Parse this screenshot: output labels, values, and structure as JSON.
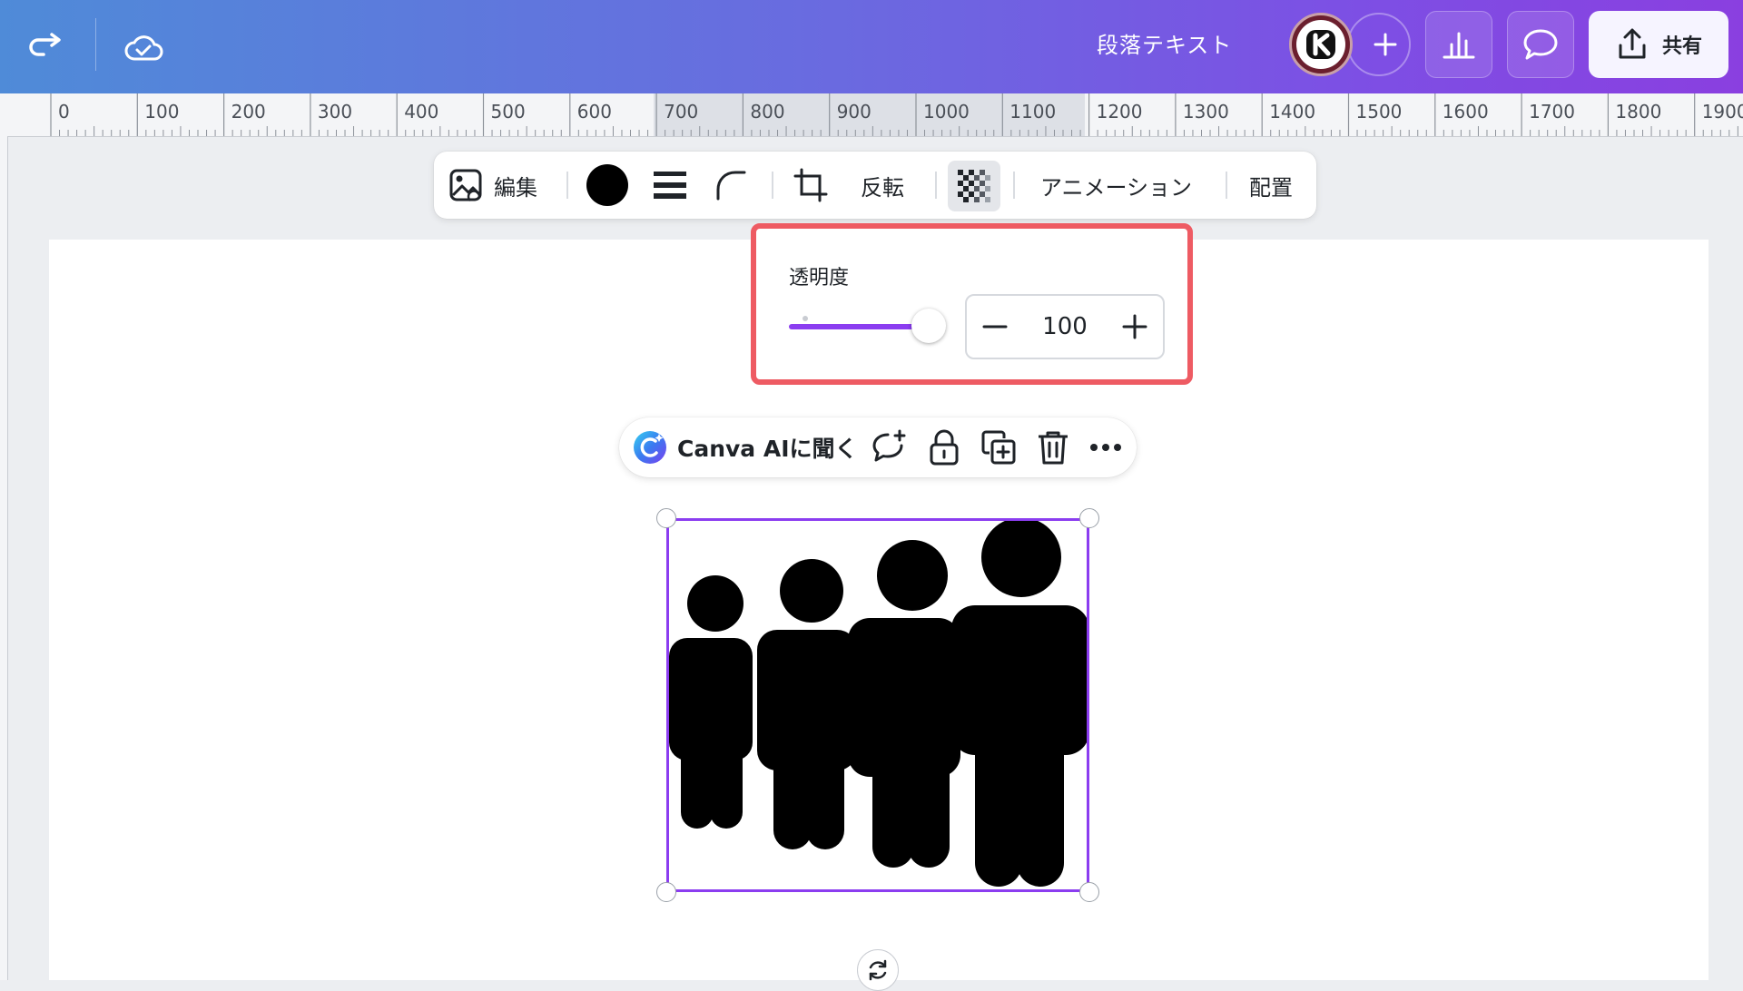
{
  "header": {
    "doc_title": "段落テキスト",
    "share_label": "共有",
    "icons": [
      "redo-icon",
      "cloud-saved-icon",
      "add-icon",
      "analytics-icon",
      "comment-icon",
      "share-upload-icon"
    ]
  },
  "ruler": {
    "labels": [
      "0",
      "100",
      "200",
      "300",
      "400",
      "500",
      "600",
      "700",
      "800",
      "900",
      "1000",
      "1100",
      "1200",
      "1300",
      "1400",
      "1500",
      "1600",
      "1700",
      "1800",
      "1900"
    ]
  },
  "toolbar": {
    "edit_label": "編集",
    "flip_label": "反転",
    "animation_label": "アニメーション",
    "position_label": "配置",
    "color": "#000000"
  },
  "transparency": {
    "label": "透明度",
    "value": "100",
    "level": 100
  },
  "quick_actions": {
    "ai_label": "Canva AIに聞く"
  },
  "colors": {
    "accent": "#8b3df0",
    "highlight": "#ee5b63"
  }
}
